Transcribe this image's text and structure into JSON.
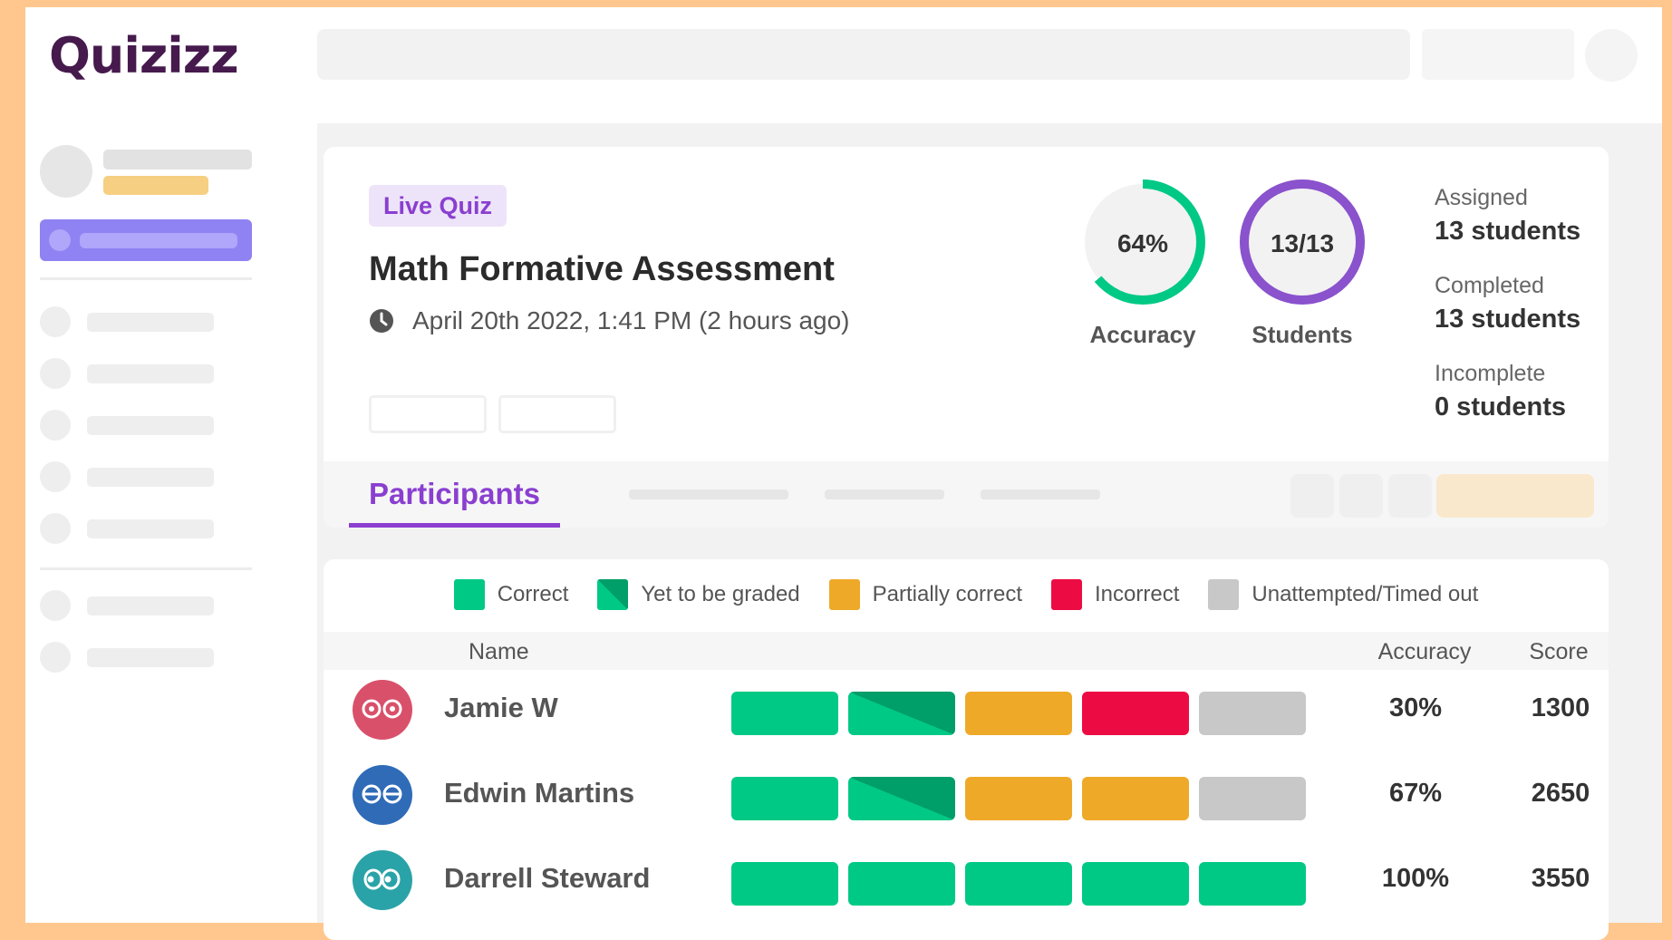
{
  "app": {
    "logo_text": "Quizizz"
  },
  "colors": {
    "accent": "#8a3fd0",
    "correct": "#00c985",
    "graded_dark": "#009e68",
    "partial": "#efa929",
    "incorrect": "#ec0b43",
    "unattempted": "#c8c8c8",
    "background": "#ffc78e"
  },
  "quiz": {
    "badge": "Live Quiz",
    "title": "Math Formative Assessment",
    "date": "April 20th 2022, 1:41 PM (2 hours ago)",
    "clock_icon": "clock-icon"
  },
  "summary": {
    "accuracy": {
      "value_text": "64%",
      "value": 0.64,
      "label": "Accuracy"
    },
    "students": {
      "value_text": "13/13",
      "value": 1.0,
      "label": "Students"
    },
    "stats": [
      {
        "label": "Assigned",
        "value": "13 students"
      },
      {
        "label": "Completed",
        "value": "13 students"
      },
      {
        "label": "Incomplete",
        "value": "0 students"
      }
    ]
  },
  "tabs": {
    "active": "Participants"
  },
  "legend": [
    {
      "label": "Correct",
      "status": "correct"
    },
    {
      "label": "Yet to be graded",
      "status": "graded"
    },
    {
      "label": "Partially correct",
      "status": "partial"
    },
    {
      "label": "Incorrect",
      "status": "incorrect"
    },
    {
      "label": "Unattempted/Timed out",
      "status": "unattempted"
    }
  ],
  "table": {
    "headers": {
      "name": "Name",
      "accuracy": "Accuracy",
      "score": "Score"
    },
    "rows": [
      {
        "name": "Jamie W",
        "avatar_color": "#d9506a",
        "avatar_icon": "eyes-round-icon",
        "responses": [
          "correct",
          "graded",
          "partial",
          "incorrect",
          "unattempted"
        ],
        "accuracy": "30%",
        "score": "1300"
      },
      {
        "name": "Edwin Martins",
        "avatar_color": "#2f6bb7",
        "avatar_icon": "eyes-sleepy-icon",
        "responses": [
          "correct",
          "graded",
          "partial",
          "partial",
          "unattempted"
        ],
        "accuracy": "67%",
        "score": "2650"
      },
      {
        "name": "Darrell Steward",
        "avatar_color": "#2aa3a8",
        "avatar_icon": "eyes-wide-icon",
        "responses": [
          "correct",
          "correct",
          "correct",
          "correct",
          "correct"
        ],
        "accuracy": "100%",
        "score": "3550"
      }
    ]
  }
}
